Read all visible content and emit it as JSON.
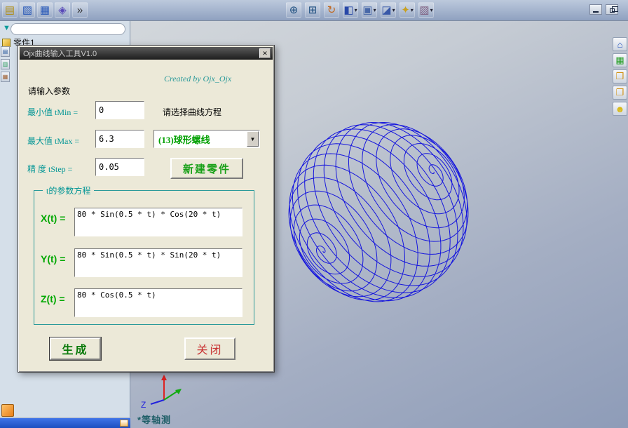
{
  "toolbars": {
    "left": [
      {
        "name": "new-document-icon",
        "glyph": "▤",
        "color": "#b08c10"
      },
      {
        "name": "open-document-icon",
        "glyph": "▧",
        "color": "#2858b8"
      },
      {
        "name": "save-document-icon",
        "glyph": "▦",
        "color": "#2858b8"
      },
      {
        "name": "reference-geometry-icon",
        "glyph": "◈",
        "color": "#5848b8"
      },
      {
        "name": "toolbar-overflow-chevron",
        "glyph": "»",
        "color": "#303030"
      }
    ],
    "view": [
      {
        "name": "zoom-in-out-icon",
        "glyph": "⊕",
        "color": "#205080"
      },
      {
        "name": "zoom-to-area-icon",
        "glyph": "⊞",
        "color": "#205080"
      },
      {
        "name": "rotate-view-icon",
        "glyph": "↻",
        "color": "#c06820"
      },
      {
        "name": "standard-views-icon",
        "glyph": "◧",
        "color": "#2848a8",
        "caret": true
      },
      {
        "name": "display-style-icon",
        "glyph": "▣",
        "color": "#4868a8",
        "caret": true
      },
      {
        "name": "section-view-icon",
        "glyph": "◪",
        "color": "#3858a8",
        "caret": true
      },
      {
        "name": "appearance-icon",
        "glyph": "✦",
        "color": "#c8a020",
        "caret": true
      },
      {
        "name": "scene-icon",
        "glyph": "▨",
        "color": "#806080",
        "caret": true
      }
    ],
    "right": [
      {
        "name": "home-icon",
        "glyph": "⌂",
        "color": "#2050c0"
      },
      {
        "name": "sketch-icon",
        "glyph": "▦",
        "color": "#28a028"
      },
      {
        "name": "folder-open-icon",
        "glyph": "❒",
        "color": "#d09010"
      },
      {
        "name": "folder-up-icon",
        "glyph": "❐",
        "color": "#d09010"
      },
      {
        "name": "help-icon",
        "glyph": "☻",
        "color": "#d8b810"
      }
    ],
    "panel_edge": [
      {
        "name": "panel-tab-1-icon",
        "glyph": "▤",
        "color": "#3060a0"
      },
      {
        "name": "panel-tab-2-icon",
        "glyph": "▥",
        "color": "#30a060"
      },
      {
        "name": "panel-tab-3-icon",
        "glyph": "▦",
        "color": "#a06030"
      }
    ]
  },
  "left_panel": {
    "tree_root_label": "零件1",
    "funnel_glyph": "▼"
  },
  "viewport": {
    "orientation_label": "*等轴测",
    "axis_z_label": "Z",
    "curve_color": "#1515dd"
  },
  "dialog": {
    "title": "Ojx曲线输入工具V1.0",
    "close_glyph": "✕",
    "credit": "Created by Ojx_Ojx",
    "params_heading": "请输入参数",
    "curve_heading": "请选择曲线方程",
    "tmin_label": "最小值 tMin =",
    "tmin_value": "0",
    "tmax_label": "最大值 tMax =",
    "tmax_value": "6.3",
    "tstep_label": "精 度 tStep =",
    "tstep_value": "0.05",
    "curve_selected": "(13)球形螺线",
    "dropdown_arrow_glyph": "▼",
    "new_part_label": "新建零件",
    "group_title": "t的参数方程",
    "x_label": "X(t) =",
    "x_value": "80 * Sin(0.5 * t) * Cos(20 * t)",
    "y_label": "Y(t) =",
    "y_value": "80 * Sin(0.5 * t) * Sin(20 * t)",
    "z_label": "Z(t) =",
    "z_value": "80 * Cos(0.5 * t)",
    "generate_label": "生成",
    "close_label": "关闭"
  }
}
